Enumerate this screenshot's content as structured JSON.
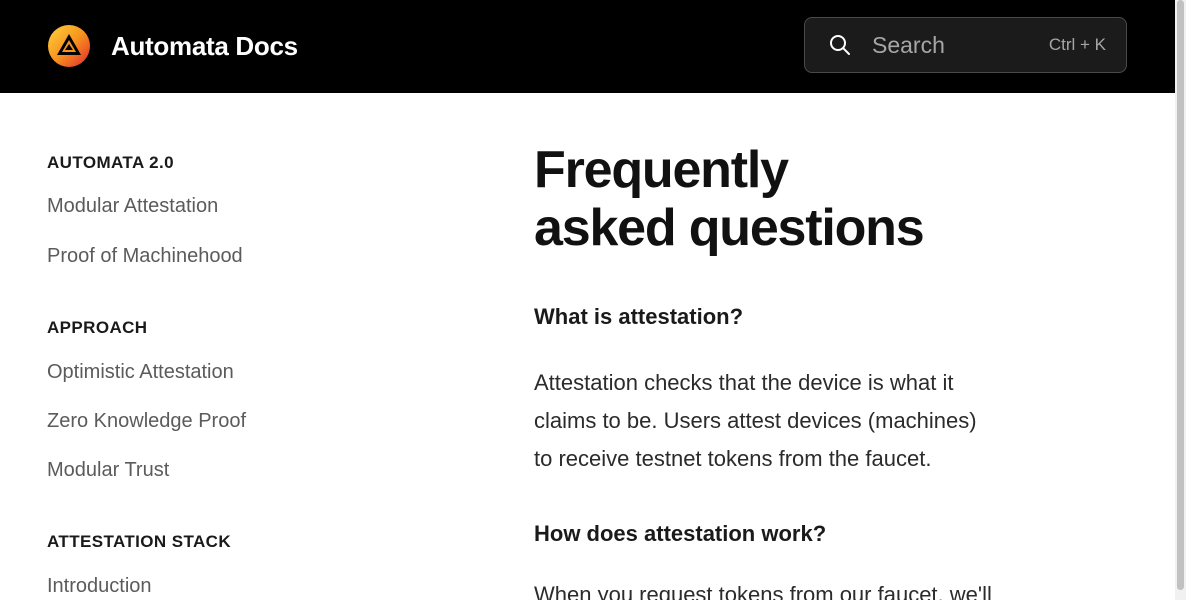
{
  "header": {
    "site_title": "Automata Docs",
    "logo_icon": "automata-logo-icon",
    "search": {
      "placeholder": "Search",
      "shortcut": "Ctrl + K",
      "icon": "search-icon"
    },
    "colors": {
      "background": "#000000",
      "logo_orange": "#f7941d",
      "logo_red": "#e3262d",
      "logo_yellow": "#ffd23f"
    }
  },
  "sidebar": {
    "sections": [
      {
        "heading": "AUTOMATA 2.0",
        "items": [
          "Modular Attestation",
          "Proof of Machinehood"
        ]
      },
      {
        "heading": "APPROACH",
        "items": [
          "Optimistic Attestation",
          "Zero Knowledge Proof",
          "Modular Trust"
        ]
      },
      {
        "heading": "ATTESTATION STACK",
        "items": [
          "Introduction"
        ]
      }
    ]
  },
  "main": {
    "title_line1": "Frequently",
    "title_line2": "asked questions",
    "faq": [
      {
        "question": "What is attestation?",
        "answer_lines": [
          "Attestation checks that the device is what it",
          "claims to be. Users attest devices (machines)",
          "to receive testnet tokens from the faucet."
        ]
      },
      {
        "question": "How does attestation work?",
        "answer_lines": [
          "When you request tokens from our faucet, we'll"
        ]
      }
    ]
  }
}
